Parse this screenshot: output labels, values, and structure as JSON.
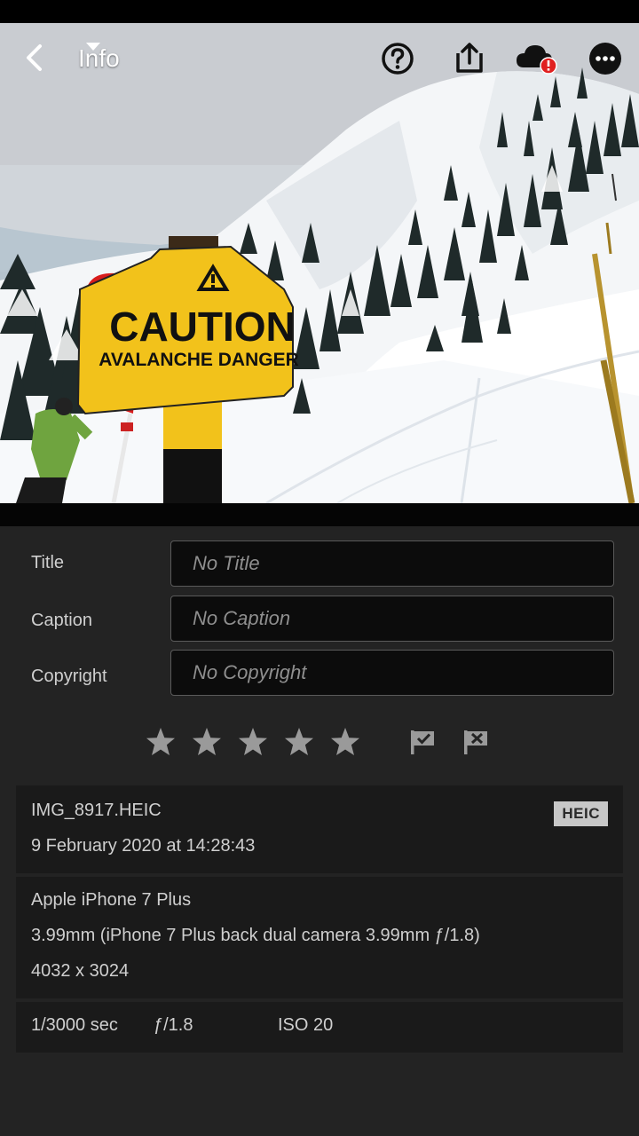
{
  "header": {
    "title": "Info",
    "icons": {
      "back": "chevron-left-icon",
      "caret": "caret-down-icon",
      "help": "help-icon",
      "share": "share-icon",
      "cloud": "cloud-error-icon",
      "more": "more-icon"
    }
  },
  "photo": {
    "sign_line1": "CAUTION",
    "sign_line2": "AVALANCHE DANGER"
  },
  "fields": [
    {
      "label": "Title",
      "placeholder": "No Title"
    },
    {
      "label": "Caption",
      "placeholder": "No Caption"
    },
    {
      "label": "Copyright",
      "placeholder": "No Copyright"
    }
  ],
  "rating": {
    "stars": 0,
    "max_stars": 5,
    "flags": [
      "flag-pick-icon",
      "flag-reject-icon"
    ]
  },
  "file_info": {
    "filename": "IMG_8917.HEIC",
    "format_badge": "HEIC",
    "date": "9 February 2020 at 14:28:43"
  },
  "camera_info": {
    "camera": "Apple iPhone 7 Plus",
    "lens": "3.99mm (iPhone 7 Plus back dual camera 3.99mm ƒ/1.8)",
    "dimensions": "4032 x 3024"
  },
  "exposure": {
    "shutter": "1/3000 sec",
    "aperture": "ƒ/1.8",
    "iso": "ISO 20"
  },
  "colors": {
    "background": "#232323",
    "panel": "#1a1a1a",
    "field_bg": "#0c0c0c",
    "sign_yellow": "#f2c21b",
    "cloud_error": "#e02020"
  }
}
